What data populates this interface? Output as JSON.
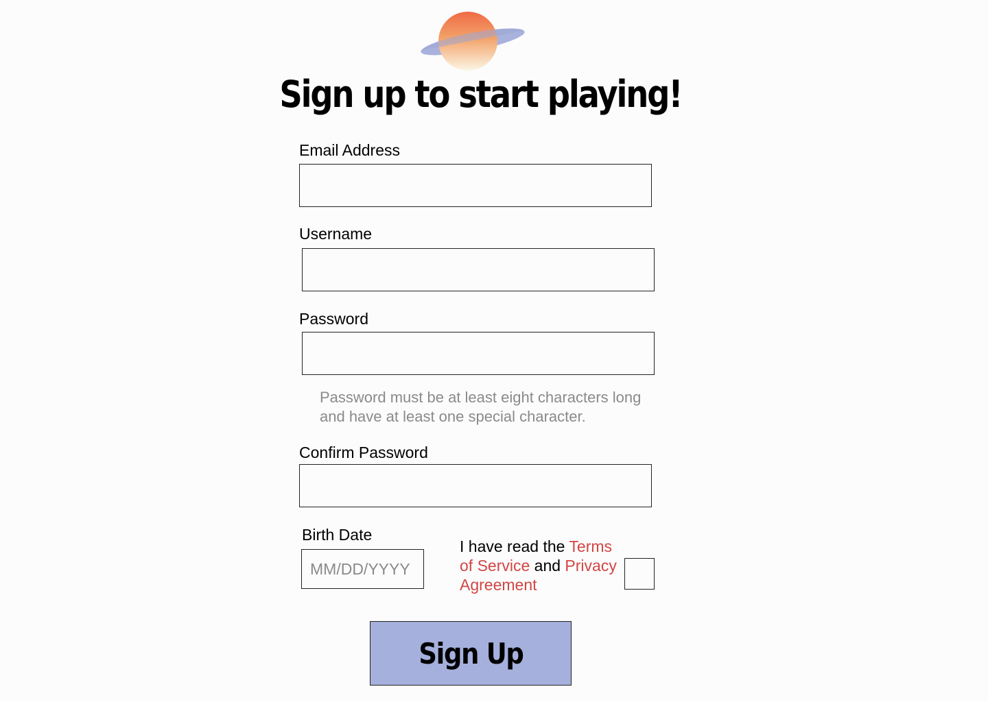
{
  "page": {
    "title": "Sign up to start playing!",
    "logo_icon": "planet-icon",
    "colors": {
      "background": "#fcfcfc",
      "accent_link": "#d24545",
      "button_fill": "#a6b0dd",
      "hint_text": "#8a8a8a"
    }
  },
  "form": {
    "email": {
      "label": "Email Address",
      "value": ""
    },
    "username": {
      "label": "Username",
      "value": ""
    },
    "password": {
      "label": "Password",
      "value": "",
      "hint": "Password must be at least eight characters long and have at least one special character."
    },
    "confirm_password": {
      "label": "Confirm Password",
      "value": ""
    },
    "birth_date": {
      "label": "Birth Date",
      "placeholder": "MM/DD/YYYY",
      "value": ""
    },
    "terms": {
      "prefix": "I have read the ",
      "terms_link": "Terms of Service",
      "middle": " and ",
      "privacy_link": "Privacy Agreement",
      "checked": false
    },
    "submit_label": "Sign Up"
  }
}
